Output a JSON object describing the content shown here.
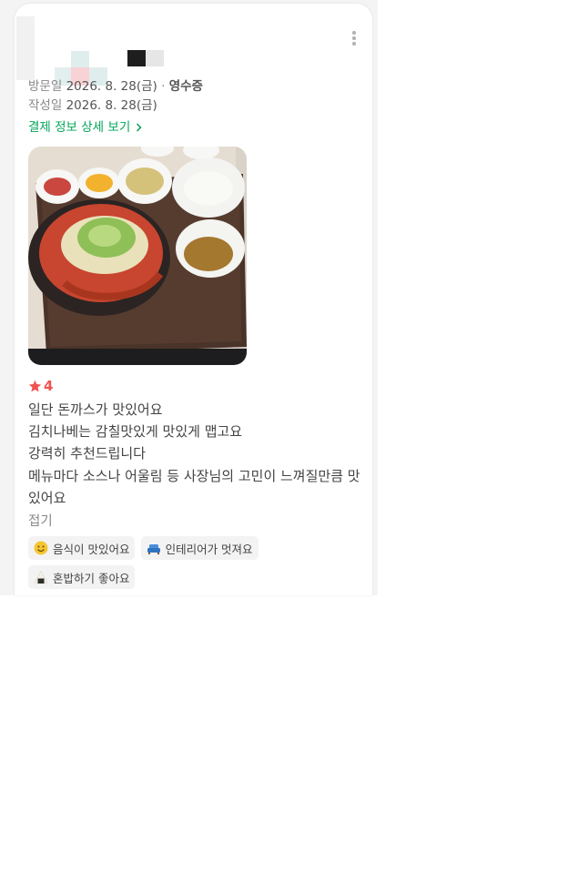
{
  "review": {
    "visit_label": "방문일",
    "visit_date": "2026. 8. 28(금)",
    "visit_separator": "·",
    "visit_place": "영수증",
    "written_label": "작성일",
    "written_date": "2026. 8. 28(금)",
    "payment_link": "결제 정보 상세 보기",
    "rating": "4",
    "text_lines": [
      "일단 돈까스가 맛있어요",
      "김치나베는 감칠맛있게 맛있게 맵고요",
      "강력히 추천드립니다",
      "메뉴마다 소스나 어울림 등 사장님의 고민이 느껴질만큼 맛있어요"
    ],
    "fold_label": "접기",
    "tags": [
      {
        "icon": "smiling-face-icon",
        "label": "음식이 맛있어요"
      },
      {
        "icon": "sofa-icon",
        "label": "인테리어가 멋져요"
      },
      {
        "icon": "rice-ball-icon",
        "label": "혼밥하기 좋아요"
      }
    ]
  },
  "colors": {
    "accent_green": "#03a55a",
    "rating_red": "#ef5350",
    "tag_background": "#f3f3f3"
  }
}
